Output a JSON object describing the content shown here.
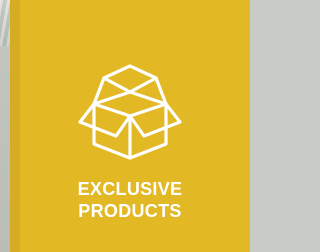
{
  "card": {
    "title_line1": "EXCLUSIVE",
    "title_line2": "PRODUCTS",
    "icon": "open-box-icon",
    "background_color": "#e2b824",
    "text_color": "#ffffff"
  }
}
